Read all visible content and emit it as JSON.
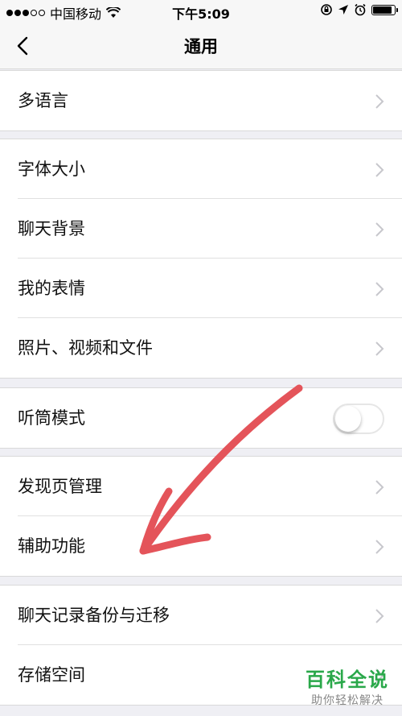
{
  "status_bar": {
    "carrier": "中国移动",
    "time": "下午5:09",
    "battery_level": 0.9
  },
  "nav": {
    "title": "通用",
    "back_icon": "chevron-left-icon"
  },
  "groups": [
    {
      "items": [
        {
          "label": "多语言"
        }
      ]
    },
    {
      "items": [
        {
          "label": "字体大小"
        },
        {
          "label": "聊天背景"
        },
        {
          "label": "我的表情"
        },
        {
          "label": "照片、视频和文件"
        }
      ]
    },
    {
      "items": [
        {
          "label": "听筒模式",
          "toggle": false
        }
      ]
    },
    {
      "items": [
        {
          "label": "发现页管理"
        },
        {
          "label": "辅助功能"
        }
      ]
    },
    {
      "items": [
        {
          "label": "聊天记录备份与迁移"
        },
        {
          "label": "存储空间"
        }
      ]
    }
  ],
  "annotation": {
    "color": "#e4545a"
  },
  "watermark": {
    "title": "百科全说",
    "subtitle": "助你轻松解决"
  }
}
